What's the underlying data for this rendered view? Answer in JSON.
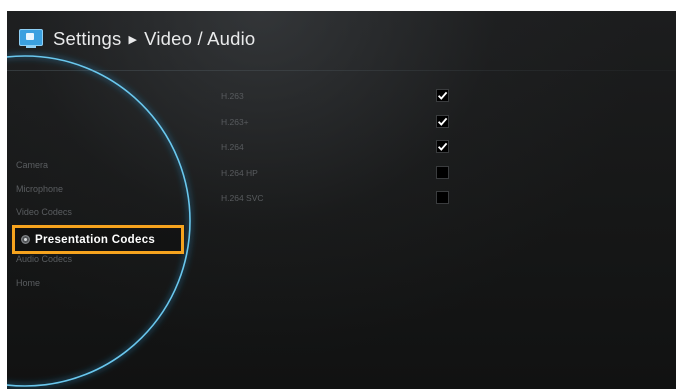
{
  "header": {
    "section": "Settings",
    "page": "Video / Audio",
    "icon": "monitor-icon"
  },
  "menu": {
    "items": [
      {
        "label": "Camera"
      },
      {
        "label": "Microphone"
      },
      {
        "label": "Video Codecs"
      },
      {
        "label": "Presentation Codecs",
        "selected": true
      },
      {
        "label": "Audio Codecs"
      },
      {
        "label": "Home"
      }
    ],
    "accent_color": "#f6a31e",
    "arc_color": "#5fc4f2"
  },
  "codecs": [
    {
      "label": "H.263",
      "checked": true
    },
    {
      "label": "H.263+",
      "checked": true
    },
    {
      "label": "H.264",
      "checked": true
    },
    {
      "label": "H.264 HP",
      "checked": false
    },
    {
      "label": "H.264 SVC",
      "checked": false
    }
  ]
}
